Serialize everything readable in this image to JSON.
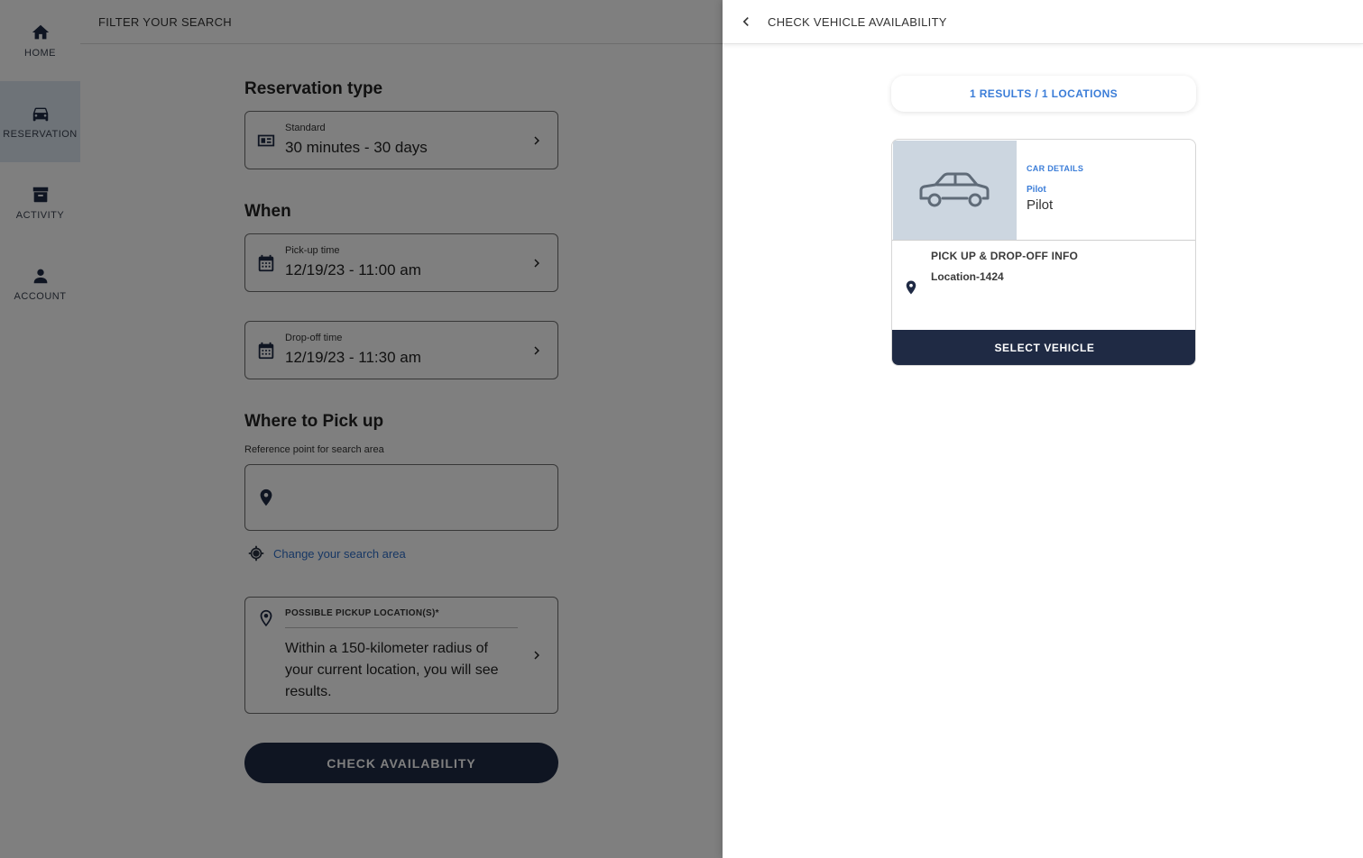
{
  "sidebar": {
    "items": [
      {
        "label": "HOME",
        "icon": "home-icon"
      },
      {
        "label": "RESERVATION",
        "icon": "car-icon"
      },
      {
        "label": "ACTIVITY",
        "icon": "archive-icon"
      },
      {
        "label": "ACCOUNT",
        "icon": "person-icon"
      }
    ],
    "active": "RESERVATION"
  },
  "header": {
    "title": "FILTER YOUR SEARCH"
  },
  "form": {
    "reservation_type": {
      "heading": "Reservation type",
      "label": "Standard",
      "value": "30 minutes - 30 days"
    },
    "when": {
      "heading": "When",
      "pickup_label": "Pick-up time",
      "pickup_value": "12/19/23 - 11:00 am",
      "dropoff_label": "Drop-off time",
      "dropoff_value": "12/19/23 - 11:30 am"
    },
    "where": {
      "heading": "Where to Pick up",
      "reference_label": "Reference point for search area",
      "reference_value": "",
      "change_area": "Change your search area",
      "pickup_locations_label": "POSSIBLE PICKUP LOCATION(S)*",
      "pickup_locations_desc": "Within a 150-kilometer radius of your current location, you will see results."
    },
    "submit_label": "CHECK AVAILABILITY"
  },
  "drawer": {
    "title": "CHECK VEHICLE AVAILABILITY",
    "results_summary": "1 RESULTS / 1 LOCATIONS",
    "vehicle": {
      "details_caption": "CAR DETAILS",
      "model_label": "Pilot",
      "model_name": "Pilot",
      "pickup_title": "PICK UP & DROP-OFF INFO",
      "location": "Location-1424",
      "select_label": "SELECT VEHICLE"
    }
  },
  "colors": {
    "primary_navy": "#1f2a44",
    "accent_blue": "#3b7dd8",
    "link_blue": "#2f6fc9",
    "car_image_bg": "#ccd6e0",
    "active_nav_bg": "#dde6f1"
  }
}
